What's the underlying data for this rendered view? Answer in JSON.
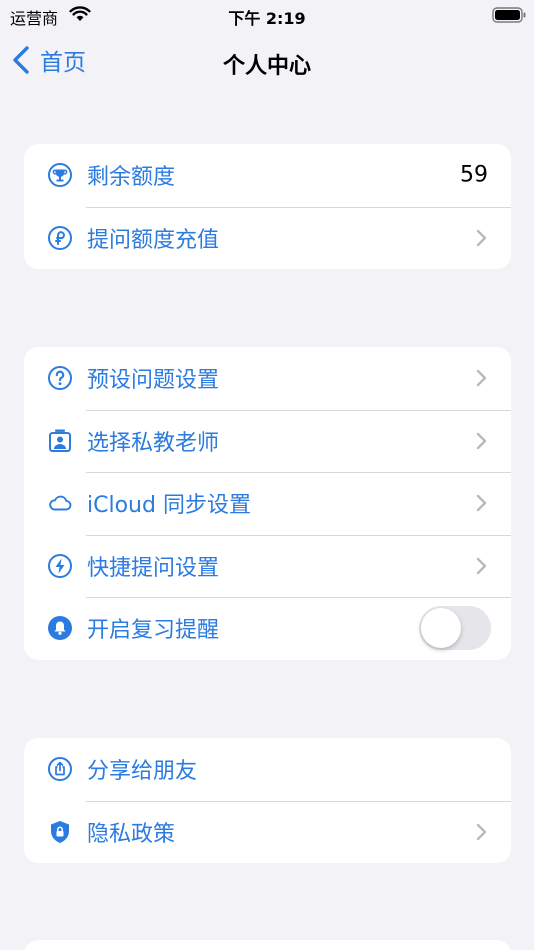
{
  "status_bar": {
    "carrier": "运营商",
    "time": "下午 2:19"
  },
  "nav": {
    "back_label": "首页",
    "title": "个人中心"
  },
  "colors": {
    "accent": "#2b7be0",
    "background": "#f2f2f7",
    "toggle_off": "#e5e5ea"
  },
  "groups": [
    {
      "rows": [
        {
          "icon": "trophy-icon",
          "label": "剩余额度",
          "value": "59"
        },
        {
          "icon": "recharge-icon",
          "label": "提问额度充值"
        }
      ]
    },
    {
      "rows": [
        {
          "icon": "question-icon",
          "label": "预设问题设置"
        },
        {
          "icon": "teacher-icon",
          "label": "选择私教老师"
        },
        {
          "icon": "cloud-icon",
          "label": "iCloud 同步设置"
        },
        {
          "icon": "bolt-icon",
          "label": "快捷提问设置"
        },
        {
          "icon": "bell-icon",
          "label": "开启复习提醒",
          "toggle_on": false
        }
      ]
    },
    {
      "rows": [
        {
          "icon": "share-icon",
          "label": "分享给朋友"
        },
        {
          "icon": "shield-icon",
          "label": "隐私政策"
        }
      ]
    }
  ]
}
